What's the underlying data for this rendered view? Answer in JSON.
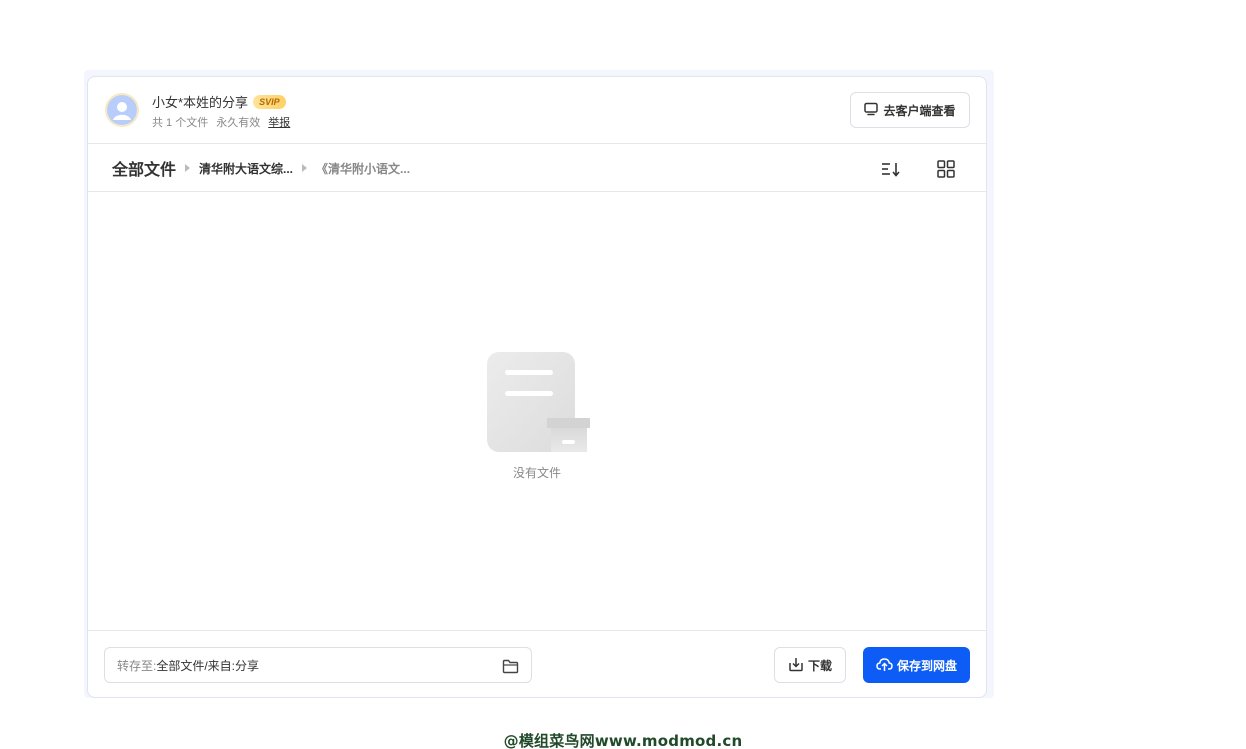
{
  "header": {
    "sharer_name": "小女*本姓的分享",
    "badge": "SVIP",
    "file_count": "共 1 个文件",
    "validity": "永久有效",
    "report_label": "举报",
    "client_button_label": "去客户端查看",
    "client_icon": "monitor-icon",
    "avatar_icon": "user-avatar-icon"
  },
  "breadcrumb": {
    "root": "全部文件",
    "items": [
      "清华附大语文综...",
      "《清华附小语文..."
    ]
  },
  "toolbar": {
    "sort_icon": "sort-icon",
    "grid_icon": "grid-view-icon"
  },
  "empty_state": {
    "text": "没有文件",
    "icon": "empty-folder-illustration"
  },
  "footer": {
    "save_to_label": "转存至:",
    "save_to_value": "全部文件/来自:分享",
    "folder_icon": "folder-icon",
    "download_label": "下载",
    "download_icon": "download-icon",
    "save_button_label": "保存到网盘",
    "save_icon": "cloud-upload-icon"
  },
  "watermark": "@模组菜鸟网www.modmod.cn",
  "colors": {
    "primary": "#0d5cf6",
    "border": "#dcdfe6",
    "muted_text": "#888888",
    "svip_gold": "#ffd066"
  }
}
